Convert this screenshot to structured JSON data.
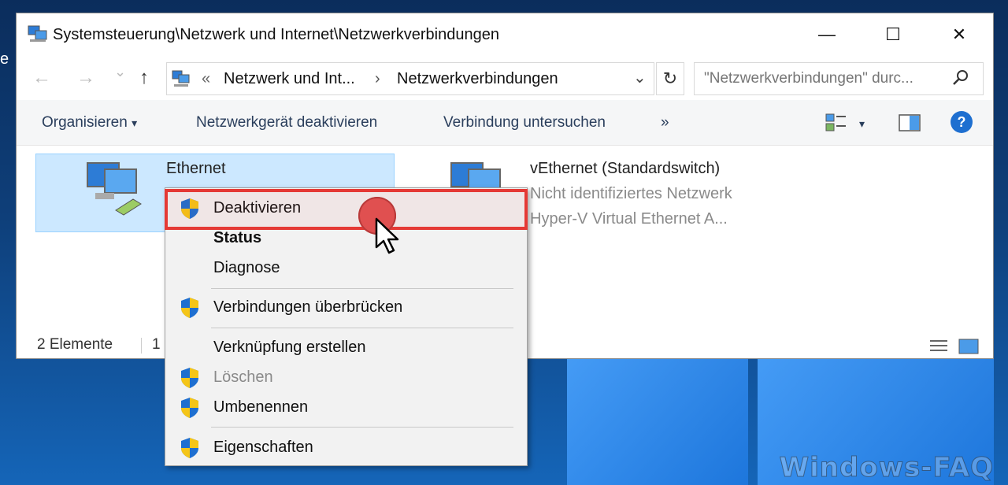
{
  "desktop": {
    "edge_char": "e",
    "watermark": "Windows-FAQ"
  },
  "window": {
    "title": "Systemsteuerung\\Netzwerk und Internet\\Netzwerkverbindungen",
    "minimize_glyph": "—",
    "maximize_glyph": "☐",
    "close_glyph": "✕"
  },
  "addressbar": {
    "back_glyph": "←",
    "forward_glyph": "→",
    "recent_glyph": "⌄",
    "up_glyph": "↑",
    "crumb_sep": "«",
    "crumb_1": "Netzwerk und Int...",
    "crumb_arrow": "›",
    "crumb_2": "Netzwerkverbindungen",
    "dropdown_glyph": "⌄",
    "refresh_glyph": "↻",
    "search_placeholder": "\"Netzwerkverbindungen\" durc...",
    "search_glyph": "⚲"
  },
  "commandbar": {
    "organize": "Organisieren",
    "organize_arrow": "▾",
    "disable_device": "Netzwerkgerät deaktivieren",
    "diagnose_connection": "Verbindung untersuchen",
    "more": "»",
    "view_arrow": "▾",
    "help": "?"
  },
  "items": [
    {
      "name": "Ethernet",
      "subtitle1": "",
      "subtitle2": ""
    },
    {
      "name": "vEthernet (Standardswitch)",
      "subtitle1": "Nicht identifiziertes Netzwerk",
      "subtitle2": "Hyper-V Virtual Ethernet A..."
    }
  ],
  "statusbar": {
    "count": "2 Elemente",
    "selected": "1"
  },
  "context_menu": {
    "items": [
      {
        "label": "Deaktivieren",
        "shield": true,
        "bold": false,
        "disabled": false
      },
      {
        "label": "Status",
        "shield": false,
        "bold": true,
        "disabled": false
      },
      {
        "label": "Diagnose",
        "shield": false,
        "bold": false,
        "disabled": false
      },
      {
        "label": "Verbindungen überbrücken",
        "shield": true,
        "bold": false,
        "disabled": false
      },
      {
        "label": "Verknüpfung erstellen",
        "shield": false,
        "bold": false,
        "disabled": false
      },
      {
        "label": "Löschen",
        "shield": true,
        "bold": false,
        "disabled": true
      },
      {
        "label": "Umbenennen",
        "shield": true,
        "bold": false,
        "disabled": false
      },
      {
        "label": "Eigenschaften",
        "shield": true,
        "bold": false,
        "disabled": false
      }
    ]
  },
  "colors": {
    "highlight_border": "#e53935",
    "selection_bg": "#cce8ff",
    "help_blue": "#1e6fd0"
  }
}
